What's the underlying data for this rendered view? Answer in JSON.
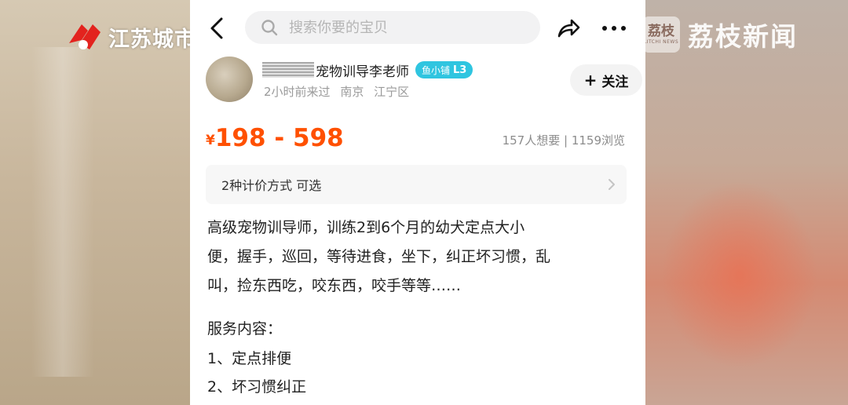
{
  "overlay": {
    "left_logo_text": "江苏城市",
    "right_logo_seal": "荔枝",
    "right_logo_seal_small": "LITCHI NEWS",
    "right_logo_text": "荔枝新闻"
  },
  "topbar": {
    "search_placeholder": "搜索你要的宝贝"
  },
  "seller": {
    "name": "宠物训导李老师",
    "badge_text": "鱼小铺",
    "badge_level": "L3",
    "last_visit": "2小时前来过",
    "location_city": "南京",
    "location_district": "江宁区",
    "follow_label": "关注"
  },
  "listing": {
    "currency": "¥",
    "price_range": "198 - 598",
    "stats": "157人想要 | 1159浏览",
    "pricing_option": "2种计价方式  可选",
    "description": [
      "高级宠物训导师，训练2到6个月的幼犬定点大小",
      "便，握手，巡回，等待进食，坐下，纠正坏习惯，乱",
      "叫，捡东西吃，咬东西，咬手等等……"
    ],
    "service_title": "服务内容：",
    "services": [
      "1、定点排便",
      "2、坏习惯纠正"
    ]
  },
  "colors": {
    "price": "#ff5000",
    "badge": "#2fc5e0",
    "search_bg": "#f2f2f3",
    "muted_text": "#9a9a9a"
  },
  "icons": [
    "back-arrow-icon",
    "search-icon",
    "share-icon",
    "more-icon",
    "chevron-right-icon",
    "plus-icon"
  ]
}
